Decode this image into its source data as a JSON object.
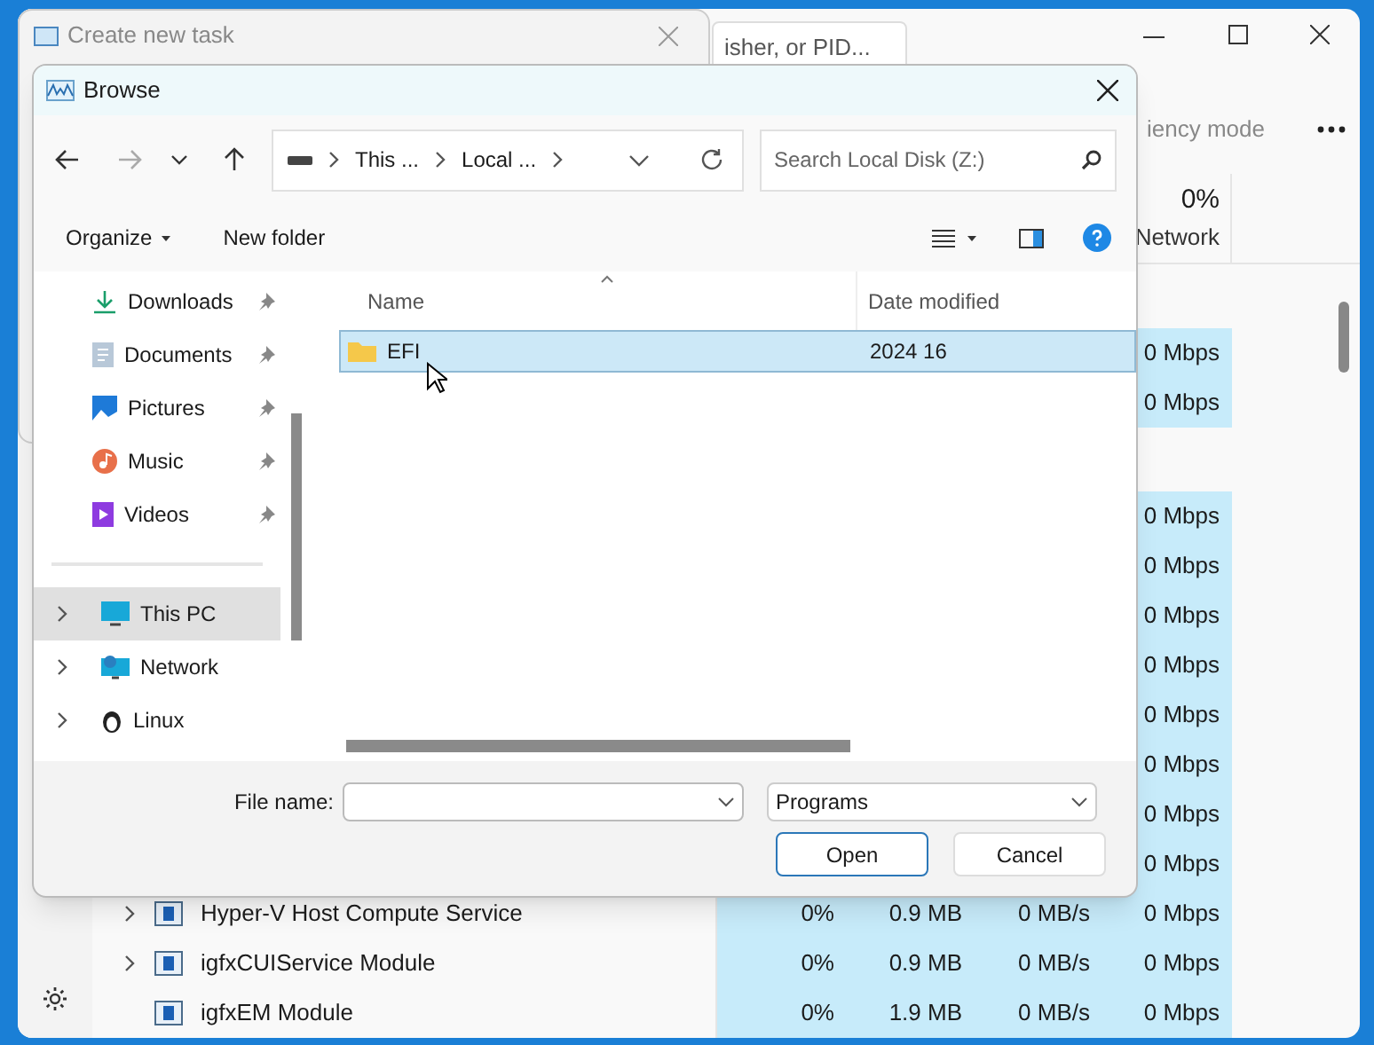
{
  "task_manager": {
    "search_text": "isher, or PID...",
    "command_label": "iency mode",
    "network_header": {
      "percent": "0%",
      "label": "Network"
    },
    "network_groups": [
      [
        "0 Mbps",
        "0 Mbps"
      ],
      [
        "0 Mbps",
        "0 Mbps",
        "0 Mbps",
        "0 Mbps",
        "0 Mbps",
        "0 Mbps",
        "0 Mbps",
        "0 Mbps"
      ]
    ],
    "processes": [
      {
        "name": "Hyper-V Host Compute Service",
        "expandable": true,
        "cpu": "0%",
        "memory": "0.9 MB",
        "disk": "0 MB/s",
        "network": "0 Mbps"
      },
      {
        "name": "igfxCUIService Module",
        "expandable": true,
        "cpu": "0%",
        "memory": "0.9 MB",
        "disk": "0 MB/s",
        "network": "0 Mbps"
      },
      {
        "name": "igfxEM Module",
        "expandable": false,
        "cpu": "0%",
        "memory": "1.9 MB",
        "disk": "0 MB/s",
        "network": "0 Mbps"
      }
    ]
  },
  "create_task_dialog": {
    "title": "Create new task"
  },
  "browse_dialog": {
    "title": "Browse",
    "breadcrumb": [
      "This ...",
      "Local ..."
    ],
    "search": {
      "placeholder": "Search Local Disk (Z:)"
    },
    "toolbar": {
      "organize": "Organize",
      "new_folder": "New folder"
    },
    "sidebar": {
      "items": [
        {
          "kind": "pinned",
          "label": "Downloads",
          "selected": false
        },
        {
          "kind": "pinned",
          "label": "Documents",
          "selected": false
        },
        {
          "kind": "pinned",
          "label": "Pictures",
          "selected": false
        },
        {
          "kind": "pinned",
          "label": "Music",
          "selected": false
        },
        {
          "kind": "pinned",
          "label": "Videos",
          "selected": false
        },
        {
          "kind": "tree",
          "label": "This PC",
          "selected": true
        },
        {
          "kind": "tree",
          "label": "Network",
          "selected": false
        },
        {
          "kind": "tree",
          "label": "Linux",
          "selected": false
        }
      ]
    },
    "columns": [
      "Name",
      "Date modified"
    ],
    "files": [
      {
        "name": "EFI",
        "date": "2024 16",
        "selected": true
      }
    ],
    "file_name_label": "File name:",
    "file_type": "Programs",
    "buttons": [
      "Open",
      "Cancel"
    ]
  }
}
